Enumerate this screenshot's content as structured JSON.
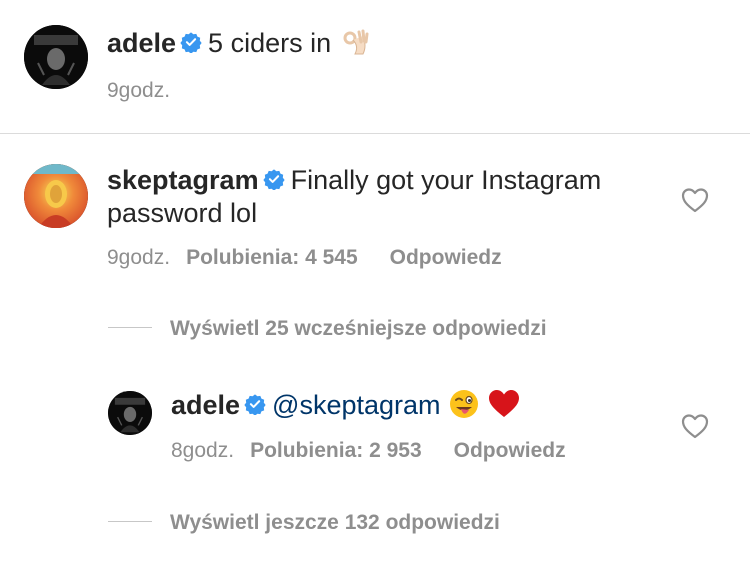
{
  "caption": {
    "username": "adele",
    "text": "5 ciders in",
    "emoji": "ok-hand-icon",
    "time": "9godz."
  },
  "comment": {
    "username": "skeptagram",
    "text_line1": "Finally got your Instagram",
    "text_line2": "password lol",
    "time": "9godz.",
    "likes": "Polubienia: 4 545",
    "reply_label": "Odpowiedz"
  },
  "earlier_replies_label": "Wyświetl 25 wcześniejsze odpowiedzi",
  "reply": {
    "username": "adele",
    "mention": "@skeptagram",
    "emojis": [
      "winking-tongue-face-icon",
      "red-heart-icon"
    ],
    "time": "8godz.",
    "likes": "Polubienia: 2 953",
    "reply_label": "Odpowiedz"
  },
  "more_replies_label": "Wyświetl jeszcze 132 odpowiedzi",
  "colors": {
    "verified": "#3897f0",
    "secondary_text": "#8e8e8e",
    "mention": "#003569",
    "divider": "#dbdbdb"
  }
}
